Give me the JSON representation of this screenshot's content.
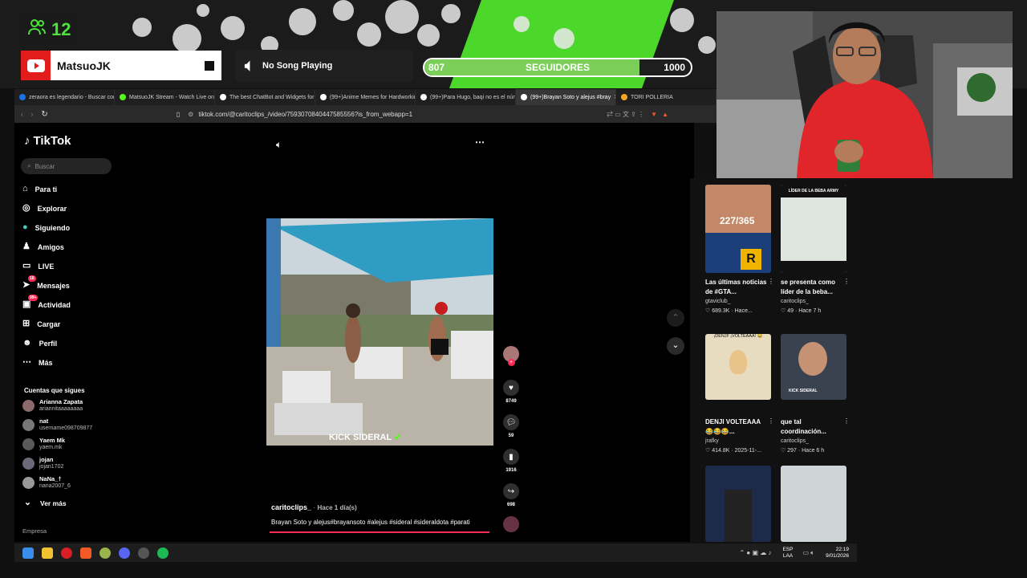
{
  "overlay": {
    "viewer_count": "12",
    "channel_name": "MatsuoJK",
    "song_status": "No Song Playing",
    "followers": {
      "current": "807",
      "label": "SEGUIDORES",
      "goal": "1000",
      "progress": 0.807
    },
    "accent": "#4bd82a"
  },
  "browser": {
    "tabs": [
      {
        "label": "zeraora es legendario - Buscar con G",
        "fav": "#1a73e8"
      },
      {
        "label": "MatsuoJK Stream - Watch Live on Ki",
        "fav": "#53fc18"
      },
      {
        "label": "The best ChatBot and Widgets for K",
        "fav": "#ffffff"
      },
      {
        "label": "(99+)Anime Memes for Hardworking",
        "fav": "#ffffff"
      },
      {
        "label": "(99+)Para Hugo, baqi no es el núme",
        "fav": "#ffffff"
      },
      {
        "label": "(99+)Brayan Soto y alejus #bray",
        "fav": "#ffffff",
        "active": true
      },
      {
        "label": "TORI POLLERIA",
        "fav": "#f5a623"
      }
    ],
    "url": "tiktok.com/@caritoclips_/video/7593070840447585556?is_from_webapp=1"
  },
  "tiktok": {
    "brand": "TikTok",
    "search_placeholder": "Buscar",
    "nav": [
      {
        "label": "Para ti",
        "icon": "home-icon",
        "glyph": "⌂"
      },
      {
        "label": "Explorar",
        "icon": "compass-icon",
        "glyph": "◎"
      },
      {
        "label": "Siguiendo",
        "icon": "following-icon",
        "glyph": "●"
      },
      {
        "label": "Amigos",
        "icon": "friends-icon",
        "glyph": "♟"
      },
      {
        "label": "LIVE",
        "icon": "live-icon",
        "glyph": "▭"
      },
      {
        "label": "Mensajes",
        "icon": "messages-icon",
        "glyph": "➤",
        "badge": "18"
      },
      {
        "label": "Actividad",
        "icon": "activity-icon",
        "glyph": "▣",
        "badge": "99+"
      },
      {
        "label": "Cargar",
        "icon": "upload-icon",
        "glyph": "⊞"
      },
      {
        "label": "Perfil",
        "icon": "profile-icon",
        "glyph": "☻"
      },
      {
        "label": "Más",
        "icon": "more-icon",
        "glyph": "⋯"
      }
    ],
    "following_header": "Cuentas que sigues",
    "following": [
      {
        "name": "Arianna Zapata",
        "user": "ariannitaaaaaaaa"
      },
      {
        "name": "nat",
        "user": "username098709877"
      },
      {
        "name": "Yaem Mk",
        "user": "yaem.mk"
      },
      {
        "name": "jojan",
        "user": "jojan1702"
      },
      {
        "name": "NaNa_†",
        "user": "nana2007_6"
      }
    ],
    "see_more": "Ver más",
    "company": "Empresa",
    "video": {
      "watermark": "KICK SIDERAL",
      "author": "caritoclips_",
      "time": "Hace 1 día(s)",
      "caption": "Brayan Soto y alejus#brayansoto #alejus #sideral #sideraldota #parati"
    },
    "actions": {
      "likes": "8749",
      "comments": "59",
      "saves": "1916",
      "shares": "698"
    },
    "related": [
      {
        "title": "Las últimas noticias de #GTA...",
        "user": "gtaviclub_",
        "stats": "♡ 689.3K · Hace...",
        "overlay": "227/365"
      },
      {
        "title": "se presenta como líder de la beba...",
        "user": "caritoclips_",
        "stats": "♡ 49 · Hace 7 h",
        "overlay": "LÍDER DE LA BEBA ARMY"
      },
      {
        "title": "DENJI VOLTEAAA 😂😂😂...",
        "user": "jrafky",
        "stats": "♡ 414.8K · 2025-11-...",
        "overlay": "¡DENJI! ¡VOLTEAAA! 😂"
      },
      {
        "title": "que tal coordinación...",
        "user": "caritoclips_",
        "stats": "♡ 297 · Hace 6 h",
        "overlay": "KICK SIDERAL"
      }
    ]
  },
  "taskbar": {
    "lang": "ESP",
    "region": "LAA",
    "time": "22:19",
    "date": "9/01/2026"
  }
}
